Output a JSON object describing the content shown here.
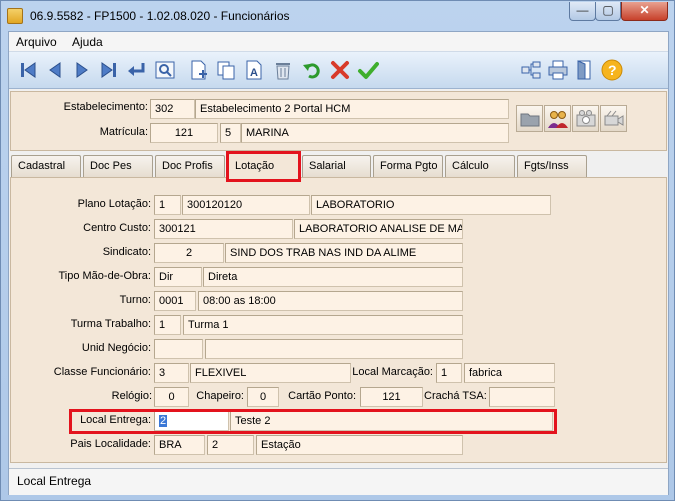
{
  "window": {
    "title": "06.9.5582 - FP1500 - 1.02.08.020 - Funcionários",
    "min": "—",
    "max": "▢",
    "close": "✕"
  },
  "menu": {
    "arquivo": "Arquivo",
    "ajuda": "Ajuda"
  },
  "toolbar": {
    "icons": [
      "first-record-icon",
      "previous-record-icon",
      "next-record-icon",
      "last-record-icon",
      "return-icon",
      "preview-icon",
      "new-document-icon",
      "copy-icon",
      "text-edit-icon",
      "trash-icon",
      "undo-icon",
      "cancel-icon",
      "confirm-icon",
      "network-icon",
      "print-icon",
      "exit-icon",
      "help-icon"
    ]
  },
  "header": {
    "estabelecimento_label": "Estabelecimento:",
    "estabelecimento_code": "302",
    "estabelecimento_name": "Estabelecimento 2 Portal HCM",
    "matricula_label": "Matrícula:",
    "matricula": "121",
    "matricula_digit": "5",
    "nome": "MARINA"
  },
  "tabs": [
    "Cadastral",
    "Doc Pes",
    "Doc Profis",
    "Lotação",
    "Salarial",
    "Forma Pgto",
    "Cálculo",
    "Fgts/Inss"
  ],
  "active_tab": "Lotação",
  "form": {
    "plano_lotacao_label": "Plano Lotação:",
    "plano_lotacao_num": "1",
    "plano_lotacao_code": "300120120",
    "plano_lotacao_desc": "LABORATORIO",
    "centro_custo_label": "Centro Custo:",
    "centro_custo_code": "300121",
    "centro_custo_desc": "LABORATORIO ANALISE DE MAT-I",
    "sindicato_label": "Sindicato:",
    "sindicato_code": "2",
    "sindicato_desc": "SIND DOS TRAB NAS IND DA ALIME",
    "tipo_mao_obra_label": "Tipo Mão-de-Obra:",
    "tipo_mao_obra_code": "Dir",
    "tipo_mao_obra_desc": "Direta",
    "turno_label": "Turno:",
    "turno_code": "0001",
    "turno_desc": "08:00 as 18:00",
    "turma_label": "Turma Trabalho:",
    "turma_code": "1",
    "turma_desc": "Turma 1",
    "unid_negocio_label": "Unid Negócio:",
    "unid_negocio_code": "",
    "unid_negocio_desc": "",
    "classe_label": "Classe Funcionário:",
    "classe_code": "3",
    "classe_desc": "FLEXIVEL",
    "local_marcacao_label": "Local Marcação:",
    "local_marcacao_code": "1",
    "local_marcacao_desc": "fabrica",
    "relogio_label": "Relógio:",
    "relogio": "0",
    "chapeiro_label": "Chapeiro:",
    "chapeiro": "0",
    "cartao_ponto_label": "Cartão Ponto:",
    "cartao_ponto": "121",
    "cracha_label": "Crachá TSA:",
    "cracha": "",
    "local_entrega_label": "Local Entrega:",
    "local_entrega_code": "2",
    "local_entrega_desc": "Teste 2",
    "pais_label": "Pais Localidade:",
    "pais_code": "BRA",
    "localidade_code": "2",
    "localidade_desc": "Estação"
  },
  "status": {
    "text": "Local Entrega"
  },
  "colors": {
    "panel": "#f3e7d8",
    "field": "#fdf2e5",
    "highlight": "#e3131d",
    "accent": "#3b78d6"
  }
}
